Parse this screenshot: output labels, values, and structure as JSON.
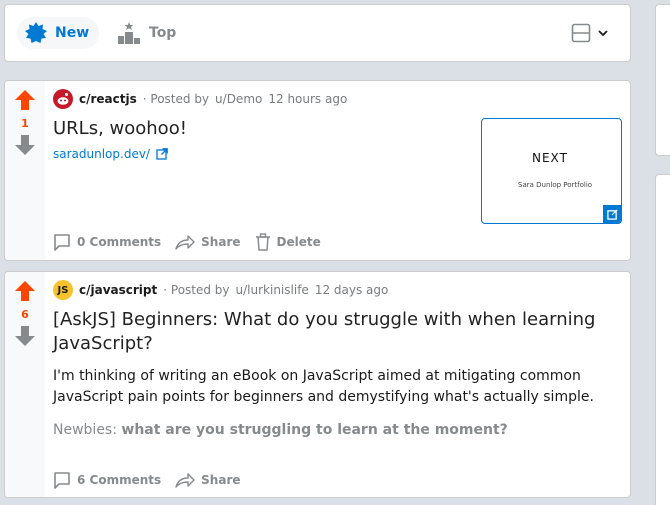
{
  "sort": {
    "new_label": "New",
    "top_label": "Top"
  },
  "posts": [
    {
      "votes": "1",
      "subreddit": "c/reactjs",
      "posted_by_prefix": "· Posted by",
      "author": "u/Demo",
      "time": "12 hours ago",
      "title": "URLs, woohoo!",
      "link": "saradunlop.dev/",
      "thumbnail": {
        "title": "NEXT",
        "subtitle": "Sara Dunlop Portfolio"
      },
      "actions": {
        "comments": "0 Comments",
        "share": "Share",
        "delete": "Delete"
      }
    },
    {
      "votes": "6",
      "subreddit": "c/javascript",
      "posted_by_prefix": "· Posted by",
      "author": "u/lurkinislife",
      "time": "12 days ago",
      "icon_text": "JS",
      "title": "[AskJS] Beginners: What do you struggle with when learning JavaScript?",
      "body": "I'm thinking of writing an eBook on JavaScript aimed at mitigating common JavaScript pain points for beginners and demystifying what's actually simple.",
      "body_muted_prefix": "Newbies:",
      "body_muted_bold": "what are you struggling to learn at the moment?",
      "actions": {
        "comments": "6 Comments",
        "share": "Share"
      }
    }
  ],
  "colors": {
    "accent": "#0079d3",
    "upvote": "#ff4500",
    "muted": "#878a8c",
    "background": "#dae0e6"
  }
}
